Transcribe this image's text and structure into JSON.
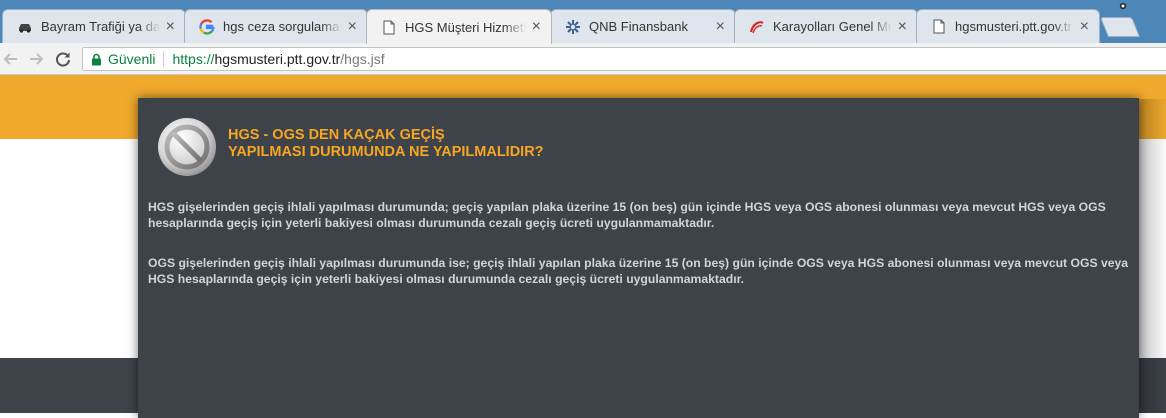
{
  "browser": {
    "tabs": [
      {
        "title": "Bayram Trafiği ya da N",
        "favicon": "car-icon",
        "active": false
      },
      {
        "title": "hgs ceza sorgulama - G",
        "favicon": "google-icon",
        "active": false
      },
      {
        "title": "HGS Müşteri Hizmetler",
        "favicon": "page-icon",
        "active": true
      },
      {
        "title": "QNB Finansbank",
        "favicon": "qnb-icon",
        "active": false
      },
      {
        "title": "Karayolları Genel Müdü",
        "favicon": "kgm-icon",
        "active": false
      },
      {
        "title": "hgsmusteri.ptt.gov.tr",
        "favicon": "page-icon",
        "active": false
      }
    ],
    "address": {
      "secure_label": "Güvenli",
      "url_scheme": "https://",
      "url_host": "hgsmusteri.ptt.gov.tr",
      "url_path": "/hgs.jsf"
    }
  },
  "modal": {
    "icon": "no-entry-icon",
    "title_line1": "HGS - OGS DEN KAÇAK GEÇİŞ",
    "title_line2": "YAPILMASI DURUMUNDA NE YAPILMALIDIR?",
    "paragraph1": "HGS gişelerinden geçiş ihlali yapılması durumunda; geçiş yapılan plaka üzerine 15 (on beş) gün içinde HGS veya OGS abonesi olunması veya mevcut HGS veya OGS hesaplarında geçiş için yeterli bakiyesi olması durumunda cezalı geçiş ücreti uygulanmamaktadır.",
    "paragraph2": "OGS gişelerinden geçiş ihlali yapılması durumunda ise; geçiş ihlali yapılan plaka üzerine 15 (on beş) gün içinde OGS veya HGS abonesi olunması veya mevcut OGS veya HGS hesaplarında geçiş için yeterli bakiyesi olması durumunda cezalı geçiş ücreti uygulanmamaktadır."
  },
  "colors": {
    "tabstrip": "#4d86b9",
    "orange_band": "#f0a92d",
    "modal_bg": "#3e4249",
    "title_accent": "#f6a623",
    "secure_green": "#0b8043"
  }
}
